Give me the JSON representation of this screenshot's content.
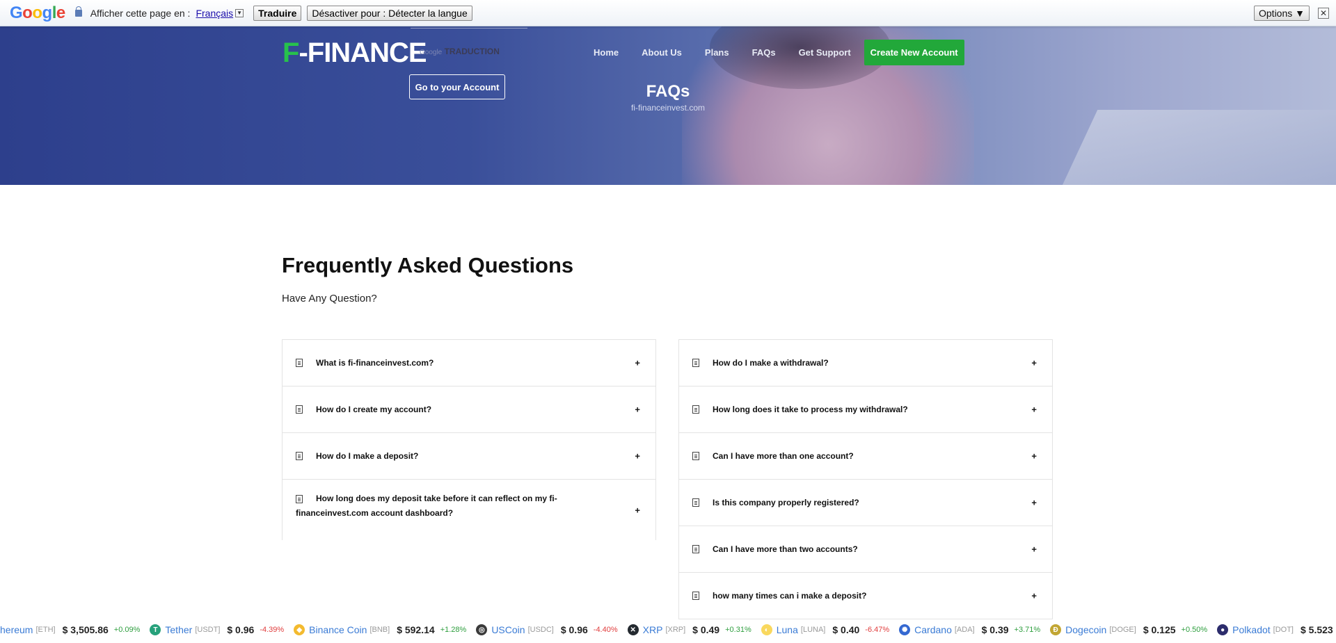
{
  "translate_bar": {
    "logo": "Google",
    "prompt": "Afficher cette page en :",
    "language": "Français",
    "translate_button": "Traduire",
    "disable_button": "Désactiver pour : Détecter la langue",
    "options_button": "Options ▼",
    "close": "✕"
  },
  "header": {
    "logo_letter": "F",
    "logo_rest": "-FINANCE",
    "gtranslate_prefix": "Google",
    "gtranslate_label": "TRADUCTION",
    "account_button": "Go to your Account",
    "nav": [
      "Home",
      "About Us",
      "Plans",
      "FAQs",
      "Get Support"
    ],
    "cta": "Create New Account",
    "title": "FAQs",
    "subtitle": "fi-financeinvest.com"
  },
  "main": {
    "title": "Frequently Asked Questions",
    "subtitle": "Have Any Question?",
    "left_questions": [
      "What is fi-financeinvest.com?",
      "How do I create my account?",
      "How do I make a deposit?",
      "How long does my deposit take before it can reflect on my fi-financeinvest.com account dashboard?"
    ],
    "right_questions": [
      "How do I make a withdrawal?",
      "How long does it take to process my withdrawal?",
      "Can I have more than one account?",
      "Is this company properly registered?",
      "Can I have more than two accounts?",
      "how many times can i make a deposit?"
    ],
    "expand_symbol": "+"
  },
  "ticker": [
    {
      "name": "hereum",
      "symbol": "[ETH]",
      "price": "$ 3,505.86",
      "change": "+0.09%",
      "dir": "up",
      "icon": "",
      "color": ""
    },
    {
      "name": "Tether",
      "symbol": "[USDT]",
      "price": "$ 0.96",
      "change": "-4.39%",
      "dir": "down",
      "icon": "T",
      "color": "#26a17b"
    },
    {
      "name": "Binance Coin",
      "symbol": "[BNB]",
      "price": "$ 592.14",
      "change": "+1.28%",
      "dir": "up",
      "icon": "◆",
      "color": "#f3ba2f"
    },
    {
      "name": "USCoin",
      "symbol": "[USDC]",
      "price": "$ 0.96",
      "change": "-4.40%",
      "dir": "down",
      "icon": "◎",
      "color": "#3a3a3a"
    },
    {
      "name": "XRP",
      "symbol": "[XRP]",
      "price": "$ 0.49",
      "change": "+0.31%",
      "dir": "up",
      "icon": "✕",
      "color": "#23292f"
    },
    {
      "name": "Luna",
      "symbol": "[LUNA]",
      "price": "$ 0.40",
      "change": "-6.47%",
      "dir": "down",
      "icon": "◐",
      "color": "#f9d85e"
    },
    {
      "name": "Cardano",
      "symbol": "[ADA]",
      "price": "$ 0.39",
      "change": "+3.71%",
      "dir": "up",
      "icon": "✺",
      "color": "#3468d1"
    },
    {
      "name": "Dogecoin",
      "symbol": "[DOGE]",
      "price": "$ 0.125",
      "change": "+0.50%",
      "dir": "up",
      "icon": "Ð",
      "color": "#c2a633"
    },
    {
      "name": "Polkadot",
      "symbol": "[DOT]",
      "price": "$ 5.523",
      "change": "",
      "dir": "up",
      "icon": "●",
      "color": "#2c2c6c"
    }
  ]
}
